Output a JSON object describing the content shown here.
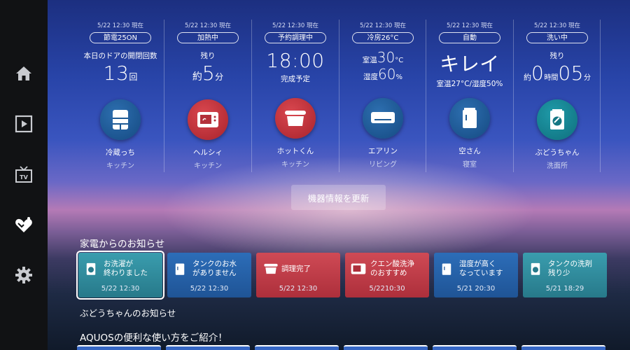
{
  "sidebar": {
    "items": [
      {
        "name": "home",
        "icon": "home-icon"
      },
      {
        "name": "video",
        "icon": "play-icon"
      },
      {
        "name": "tv",
        "icon": "tv-icon"
      },
      {
        "name": "favorite",
        "icon": "heart-icon"
      },
      {
        "name": "settings",
        "icon": "gear-icon"
      }
    ]
  },
  "devices": [
    {
      "timestamp": "5/22 12:30 現在",
      "mode": "節電25ON",
      "status_label": "本日のドアの開閉回数",
      "value": "13",
      "unit": "回",
      "name": "冷蔵っち",
      "room": "キッチン",
      "icon": "fridge-icon",
      "color": "blue"
    },
    {
      "timestamp": "5/22 12:30 現在",
      "mode": "加熱中",
      "status_label": "残り",
      "prefix": "約",
      "value": "5",
      "unit": "分",
      "name": "ヘルシィ",
      "room": "キッチン",
      "icon": "microwave-icon",
      "color": "red"
    },
    {
      "timestamp": "5/22 12:30 現在",
      "mode": "予約調理中",
      "value": "18:00",
      "sub": "完成予定",
      "name": "ホットくん",
      "room": "キッチン",
      "icon": "pot-icon",
      "color": "red"
    },
    {
      "timestamp": "5/22 12:30 現在",
      "mode": "冷房26°C",
      "room_label": "室温",
      "room_value": "30",
      "room_unit": "°C",
      "hum_label": "湿度",
      "hum_value": "60",
      "hum_unit": "%",
      "name": "エアリン",
      "room": "リビング",
      "icon": "aircon-icon",
      "color": "blue"
    },
    {
      "timestamp": "5/22 12:30 現在",
      "mode": "自動",
      "value": "キレイ",
      "sub": "室温27°C/湿度50%",
      "name": "空さん",
      "room": "寝室",
      "icon": "air-purifier-icon",
      "color": "blue"
    },
    {
      "timestamp": "5/22 12:30 現在",
      "mode": "洗い中",
      "status_label": "残り",
      "h_value": "0",
      "h_unit": "時間",
      "m_value": "05",
      "m_unit": "分",
      "name": "ぶどうちゃん",
      "room": "洗面所",
      "icon": "washer-icon",
      "color": "teal"
    }
  ],
  "refresh_label": "機器情報を更新",
  "notices_title": "家電からのお知らせ",
  "notices": [
    {
      "text": "お洗濯が\n終わりました",
      "time": "5/22 12:30",
      "icon": "washer-icon",
      "color": "teal",
      "selected": true
    },
    {
      "text": "タンクのお水\nがありません",
      "time": "5/22 12:30",
      "icon": "air-purifier-icon",
      "color": "blue"
    },
    {
      "text": "調理完了",
      "time": "5/22 12:30",
      "icon": "pot-icon",
      "color": "red"
    },
    {
      "text": "クエン酸洗浄\nのおすすめ",
      "time": "5/2210:30",
      "icon": "microwave-icon",
      "color": "red"
    },
    {
      "text": "湿度が高く\nなっています",
      "time": "5/21 20:30",
      "icon": "air-purifier-icon",
      "color": "blue"
    },
    {
      "text": "タンクの洗剤\n残り少",
      "time": "5/21 18:29",
      "icon": "washer-icon",
      "color": "teal"
    }
  ],
  "selected_notice_caption": "ぶどうちゃんのお知らせ",
  "tips_title": "AQUOSの便利な使い方をご紹介！"
}
